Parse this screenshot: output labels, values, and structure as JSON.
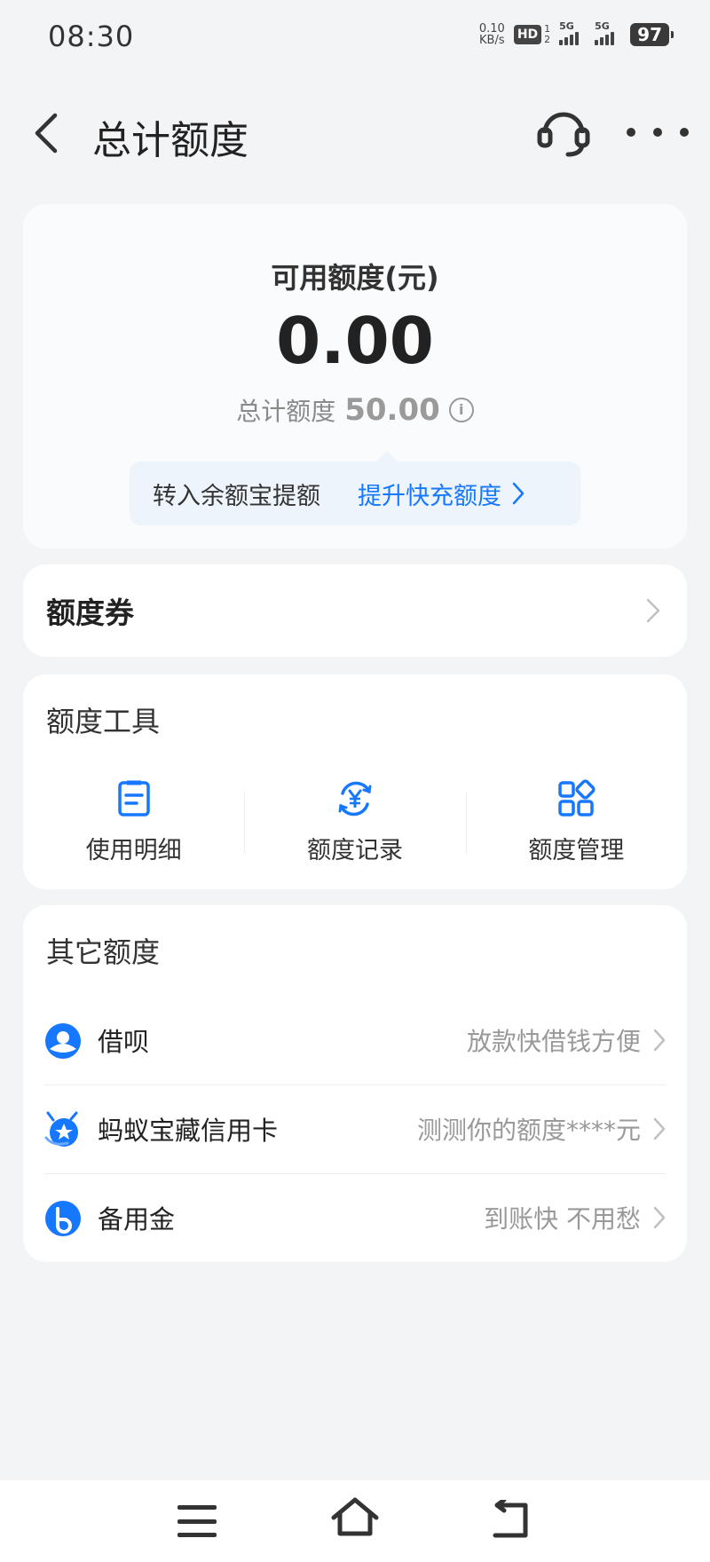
{
  "status_bar": {
    "time": "08:30",
    "net_speed_value": "0.10",
    "net_speed_unit": "KB/s",
    "hd_label": "HD",
    "hd_sim_top": "1",
    "hd_sim_bottom": "2",
    "signal1_label": "5G",
    "signal2_label": "5G",
    "battery": "97"
  },
  "nav": {
    "title": "总计额度"
  },
  "quota": {
    "available_label": "可用额度(元)",
    "available_value": "0.00",
    "total_label": "总计额度",
    "total_value": "50.00",
    "info_glyph": "i",
    "promo_left": "转入余额宝提额",
    "promo_right": "提升快充额度"
  },
  "coupon": {
    "title": "额度券"
  },
  "tools": {
    "title": "额度工具",
    "items": [
      {
        "label": "使用明细",
        "icon": "document-list-icon"
      },
      {
        "label": "额度记录",
        "icon": "yuan-cycle-icon"
      },
      {
        "label": "额度管理",
        "icon": "grid-apps-icon"
      }
    ]
  },
  "other": {
    "title": "其它额度",
    "items": [
      {
        "label": "借呗",
        "desc": "放款快借钱方便",
        "icon": "jiebei-icon"
      },
      {
        "label": "蚂蚁宝藏信用卡",
        "desc": "测测你的额度****元",
        "icon": "ant-credit-card-icon"
      },
      {
        "label": "备用金",
        "desc": "到账快 不用愁",
        "icon": "beiyongjin-icon"
      }
    ]
  },
  "colors": {
    "accent": "#1677ff",
    "background": "#f3f4f6"
  }
}
